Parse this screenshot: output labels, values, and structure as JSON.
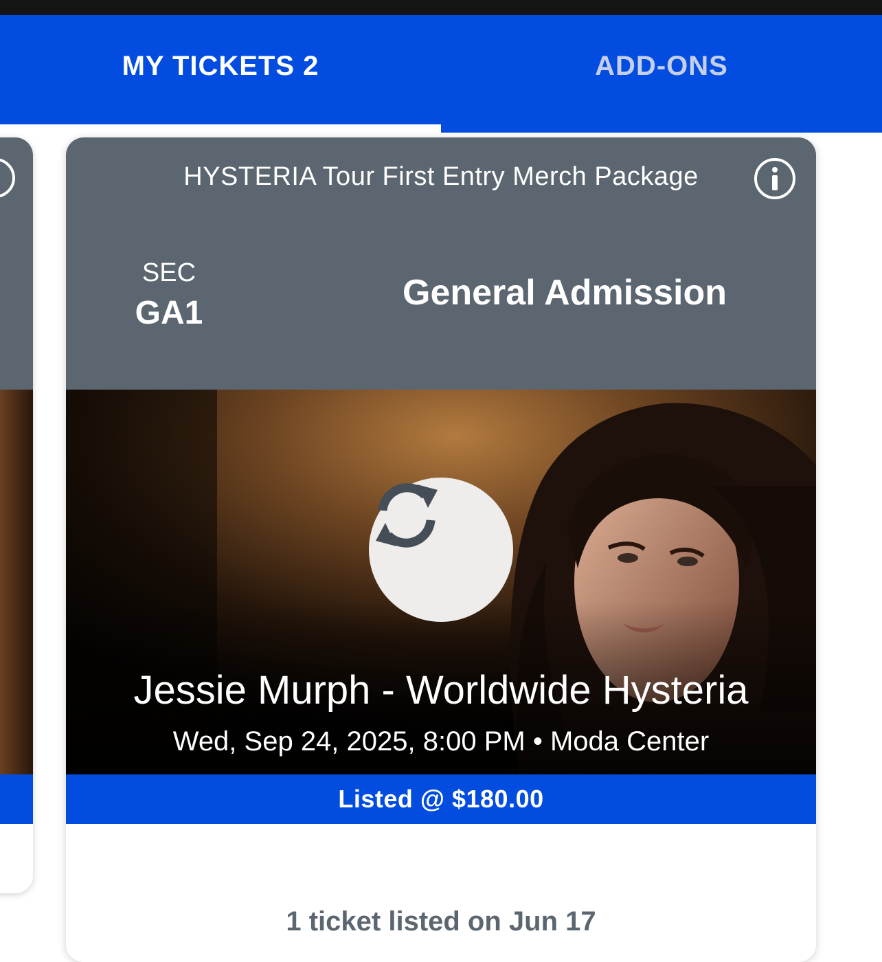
{
  "tabs": {
    "my_tickets": "MY TICKETS 2",
    "add_ons": "ADD-ONS"
  },
  "ticket": {
    "package_title": "HYSTERIA Tour First Entry Merch Package",
    "sec_label": "SEC",
    "sec_value": "GA1",
    "admission": "General Admission",
    "event_title": "Jessie Murph - Worldwide Hysteria",
    "event_datetime": "Wed, Sep 24, 2025, 8:00 PM",
    "separator": "•",
    "venue": "Moda Center",
    "listed_price": "Listed @ $180.00",
    "listed_note": "1 ticket listed on Jun 17"
  },
  "icons": {
    "info": "info-icon",
    "refresh": "refresh-icon"
  },
  "colors": {
    "brand_blue": "#024ddf",
    "header_gray": "#5b6670",
    "tab_inactive": "#c5cfe8"
  }
}
